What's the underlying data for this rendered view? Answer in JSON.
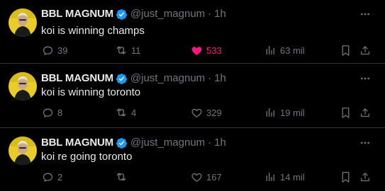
{
  "colors": {
    "background": "#000000",
    "divider": "#2f3336",
    "text_primary": "#e7e9ea",
    "text_secondary": "#71767b",
    "verified_blue": "#1d9bf0",
    "like_pink": "#f91880"
  },
  "icons": {
    "verified": "verified-badge-icon",
    "more": "more-horizontal-icon",
    "reply": "reply-bubble-icon",
    "repost": "repost-arrows-icon",
    "like": "heart-icon",
    "views": "bar-chart-icon",
    "bookmark": "bookmark-icon",
    "share": "share-upload-icon"
  },
  "tweets": [
    {
      "author": {
        "name": "BBL MAGNUM",
        "handle": "@just_magnum"
      },
      "separator": "·",
      "time": "1h",
      "text": "koi is winning champs",
      "actions": {
        "replies": "39",
        "reposts": "11",
        "likes": "533",
        "liked": true,
        "views": "63 mil"
      }
    },
    {
      "author": {
        "name": "BBL MAGNUM",
        "handle": "@just_magnum"
      },
      "separator": "·",
      "time": "1h",
      "text": "koi is winning toronto",
      "actions": {
        "replies": "8",
        "reposts": "4",
        "likes": "329",
        "liked": false,
        "views": "19 mil"
      }
    },
    {
      "author": {
        "name": "BBL MAGNUM",
        "handle": "@just_magnum"
      },
      "separator": "·",
      "time": "1h",
      "text": "koi re going toronto",
      "actions": {
        "replies": "2",
        "reposts": "",
        "likes": "167",
        "liked": false,
        "views": "14 mil"
      }
    }
  ]
}
